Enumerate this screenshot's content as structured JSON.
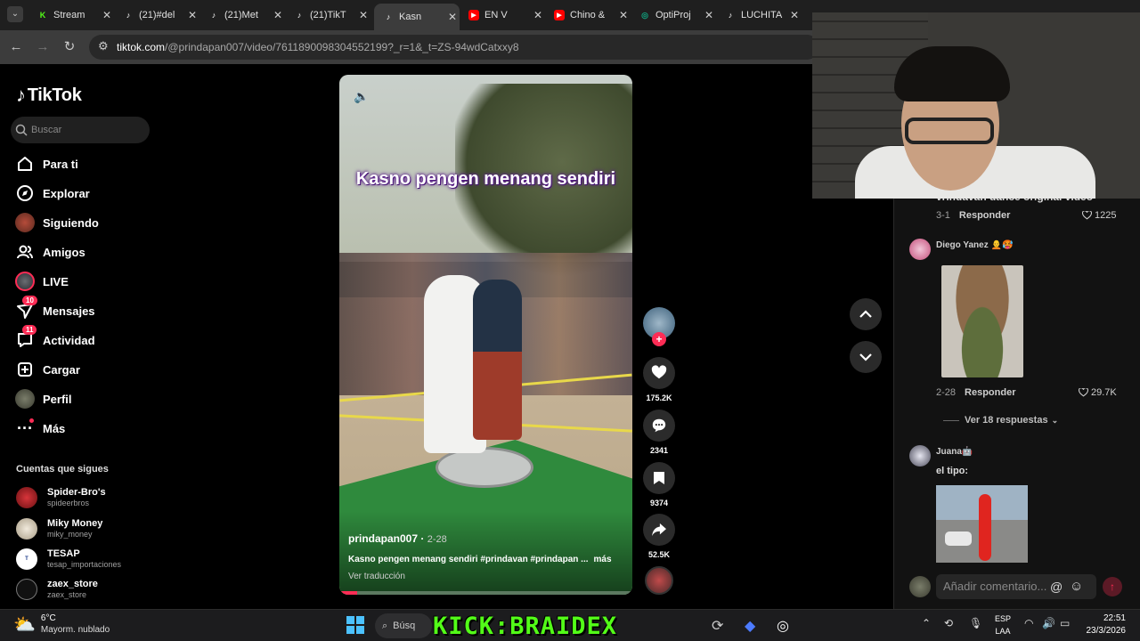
{
  "browser": {
    "tabs": [
      {
        "title": "Stream",
        "icon": "kick-icon",
        "color": "#53fc18"
      },
      {
        "title": "(21)#del",
        "icon": "tiktok-icon",
        "color": "#ffffff"
      },
      {
        "title": "(21)Met",
        "icon": "tiktok-icon",
        "color": "#ffffff"
      },
      {
        "title": "(21)TikT",
        "icon": "tiktok-icon",
        "color": "#ffffff"
      },
      {
        "title": "Kasn",
        "icon": "tiktok-icon",
        "color": "#ffffff",
        "active": true
      },
      {
        "title": "EN V",
        "icon": "youtube-icon",
        "color": "#ff0000"
      },
      {
        "title": "Chino &",
        "icon": "youtube-icon",
        "color": "#ff0000"
      },
      {
        "title": "OptiProj",
        "icon": "openai-icon",
        "color": "#10a37f"
      },
      {
        "title": "LUCHITA",
        "icon": "tiktok-icon",
        "color": "#ffffff"
      }
    ],
    "url_domain": "tiktok.com",
    "url_path": "/@prindapan007/video/7611890098304552199?_r=1&_t=ZS-94wdCatxxy8"
  },
  "sidebar": {
    "logo": "TikTok",
    "search_placeholder": "Buscar",
    "nav": [
      {
        "label": "Para ti",
        "icon": "home-icon"
      },
      {
        "label": "Explorar",
        "icon": "compass-icon"
      },
      {
        "label": "Siguiendo",
        "icon": "following-avatar-icon"
      },
      {
        "label": "Amigos",
        "icon": "friends-icon"
      },
      {
        "label": "LIVE",
        "icon": "live-icon"
      },
      {
        "label": "Mensajes",
        "icon": "messages-icon",
        "badge": "10"
      },
      {
        "label": "Actividad",
        "icon": "activity-icon",
        "badge": "11"
      },
      {
        "label": "Cargar",
        "icon": "upload-icon"
      },
      {
        "label": "Perfil",
        "icon": "profile-avatar-icon"
      },
      {
        "label": "Más",
        "icon": "more-icon"
      }
    ],
    "following_title": "Cuentas que sigues",
    "following": [
      {
        "name": "Spider-Bro's",
        "handle": "spideerbros",
        "color": "#c0282d"
      },
      {
        "name": "Miky Money",
        "handle": "miky_money",
        "color": "#e8e0d0"
      },
      {
        "name": "TESAP",
        "handle": "tesap_importaciones",
        "color": "#ffffff"
      },
      {
        "name": "zaex_store",
        "handle": "zaex_store",
        "color": "#111111"
      }
    ]
  },
  "video": {
    "caption": "Kasno pengen menang sendiri",
    "author": "prindapan007",
    "date": "2-28",
    "description": "Kasno pengen menang sendiri #prindavan #prindapan ...",
    "more": "más",
    "translate": "Ver traducción",
    "progress": 0.06,
    "likes": "175.2K",
    "comments": "2341",
    "saves": "9374",
    "shares": "52.5K"
  },
  "comments": {
    "partial_text": "vrindavan dance original video",
    "first": {
      "date": "3-1",
      "reply": "Responder",
      "likes": "1225"
    },
    "second": {
      "user": "Diego Yanez 🧑‍🦲🥵",
      "date": "2-28",
      "reply": "Responder",
      "likes": "29.7K",
      "image": "crocodile-hair-meme"
    },
    "more_replies": "Ver 18 respuestas",
    "third": {
      "user": "Juana🤖",
      "text": "el tipo:",
      "image": "inflatable-tube-man"
    },
    "input_placeholder": "Añadir comentario..."
  },
  "taskbar": {
    "temperature": "6°C",
    "weather": "Mayorm. nublado",
    "search": "Búsq",
    "overlay": "KICK:BRAIDEX",
    "lang1": "ESP",
    "lang2": "LAA",
    "time": "22:51",
    "date": "23/3/2026"
  },
  "colors": {
    "accent": "#fe2c55",
    "kick": "#53fc18"
  }
}
